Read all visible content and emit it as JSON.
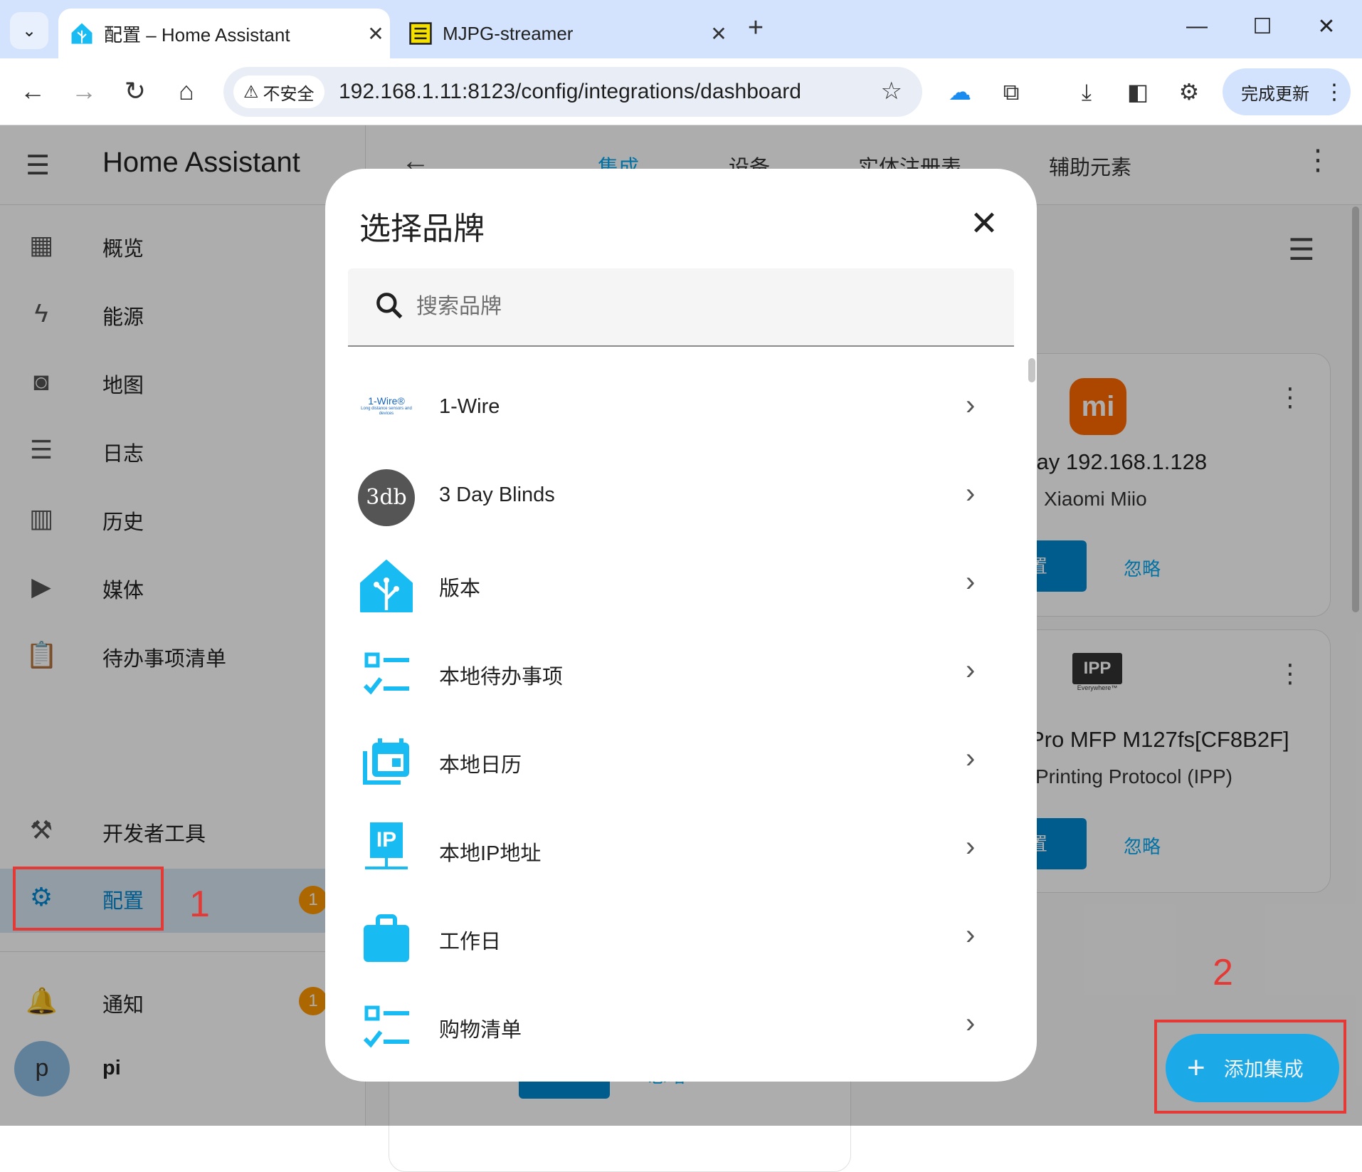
{
  "browser": {
    "tabs": [
      {
        "title": "配置 – Home Assistant",
        "active": true
      },
      {
        "title": "MJPG-streamer",
        "active": false
      }
    ],
    "security_label": "不安全",
    "url": "192.168.1.11:8123/config/integrations/dashboard",
    "update_button": "完成更新"
  },
  "sidebar": {
    "title": "Home Assistant",
    "items": [
      {
        "label": "概览",
        "icon": "dashboard-icon"
      },
      {
        "label": "能源",
        "icon": "lightning-icon"
      },
      {
        "label": "地图",
        "icon": "map-person-icon"
      },
      {
        "label": "日志",
        "icon": "list-icon"
      },
      {
        "label": "历史",
        "icon": "chart-bar-icon"
      },
      {
        "label": "媒体",
        "icon": "media-play-icon"
      },
      {
        "label": "待办事项清单",
        "icon": "clipboard-list-icon"
      }
    ],
    "dev_tools": "开发者工具",
    "config": "配置",
    "config_badge": "1",
    "notifications": "通知",
    "notifications_badge": "1",
    "avatar_letter": "p",
    "user": "pi"
  },
  "main": {
    "tabs": [
      "集成",
      "设备",
      "实体注册表",
      "辅助元素"
    ],
    "card1": {
      "title": "vay 192.168.1.128",
      "subtitle": "Xiaomi Miio",
      "configure": "置",
      "ignore": "忽略"
    },
    "card2": {
      "title": "Pro MFP M127fs[CF8B2F]",
      "subtitle": "Printing Protocol (IPP)",
      "configure": "置",
      "ignore": "忽略",
      "logo_text": "IPP",
      "logo_subtext": "Everywhere™"
    },
    "card3": {
      "configure": "配置",
      "ignore": "忽略"
    },
    "add_integration": "添加集成"
  },
  "dialog": {
    "title": "选择品牌",
    "search_placeholder": "搜索品牌",
    "brands": [
      {
        "name": "1-Wire",
        "logo_text": "1-Wire®",
        "logo_subtext": "Long distance sensors and devices"
      },
      {
        "name": "3 Day Blinds",
        "logo_text": "3db"
      },
      {
        "name": "版本"
      },
      {
        "name": "本地待办事项"
      },
      {
        "name": "本地日历"
      },
      {
        "name": "本地IP地址",
        "logo_text": "IP"
      },
      {
        "name": "工作日"
      },
      {
        "name": "购物清单"
      }
    ]
  },
  "annotations": {
    "one": "1",
    "two": "2"
  },
  "colors": {
    "accent": "#03a9f4",
    "primary_dark": "#0288d1",
    "badge": "#ff9800",
    "annotation": "#e53935"
  }
}
